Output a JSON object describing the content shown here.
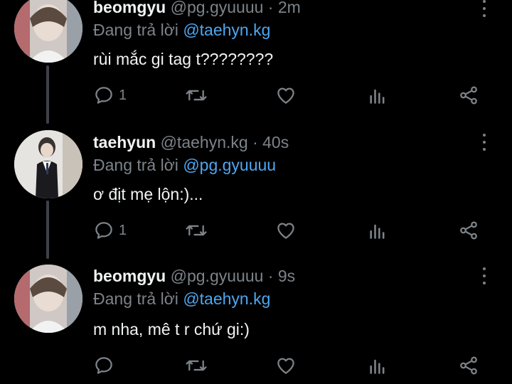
{
  "colors": {
    "background": "#000000",
    "muted": "#7c8389",
    "mention": "#4ea6ef",
    "text": "#f1f3f4"
  },
  "tweets": [
    {
      "name": "beomgyu",
      "handle": "@pg.gyuuuu",
      "separator": "·",
      "time": "2m",
      "replying_label": "Đang trả lời",
      "replying_to": "@taehyn.kg",
      "text": "rùi mắc gi tag t????????",
      "reply_count": "1",
      "icons": [
        "reply-icon",
        "retweet-icon",
        "like-icon",
        "analytics-icon",
        "share-icon",
        "more-icon"
      ]
    },
    {
      "name": "taehyun",
      "handle": "@taehyn.kg",
      "separator": "·",
      "time": "40s",
      "replying_label": "Đang trả lời",
      "replying_to": "@pg.gyuuuu",
      "text": "ơ địt mẹ lộn:)...",
      "reply_count": "1",
      "icons": [
        "reply-icon",
        "retweet-icon",
        "like-icon",
        "analytics-icon",
        "share-icon",
        "more-icon"
      ]
    },
    {
      "name": "beomgyu",
      "handle": "@pg.gyuuuu",
      "separator": "·",
      "time": "9s",
      "replying_label": "Đang trả lời",
      "replying_to": "@taehyn.kg",
      "text": "m nha, mê t r chứ gi:)",
      "reply_count": "",
      "icons": [
        "reply-icon",
        "retweet-icon",
        "like-icon",
        "analytics-icon",
        "share-icon",
        "more-icon"
      ]
    }
  ]
}
